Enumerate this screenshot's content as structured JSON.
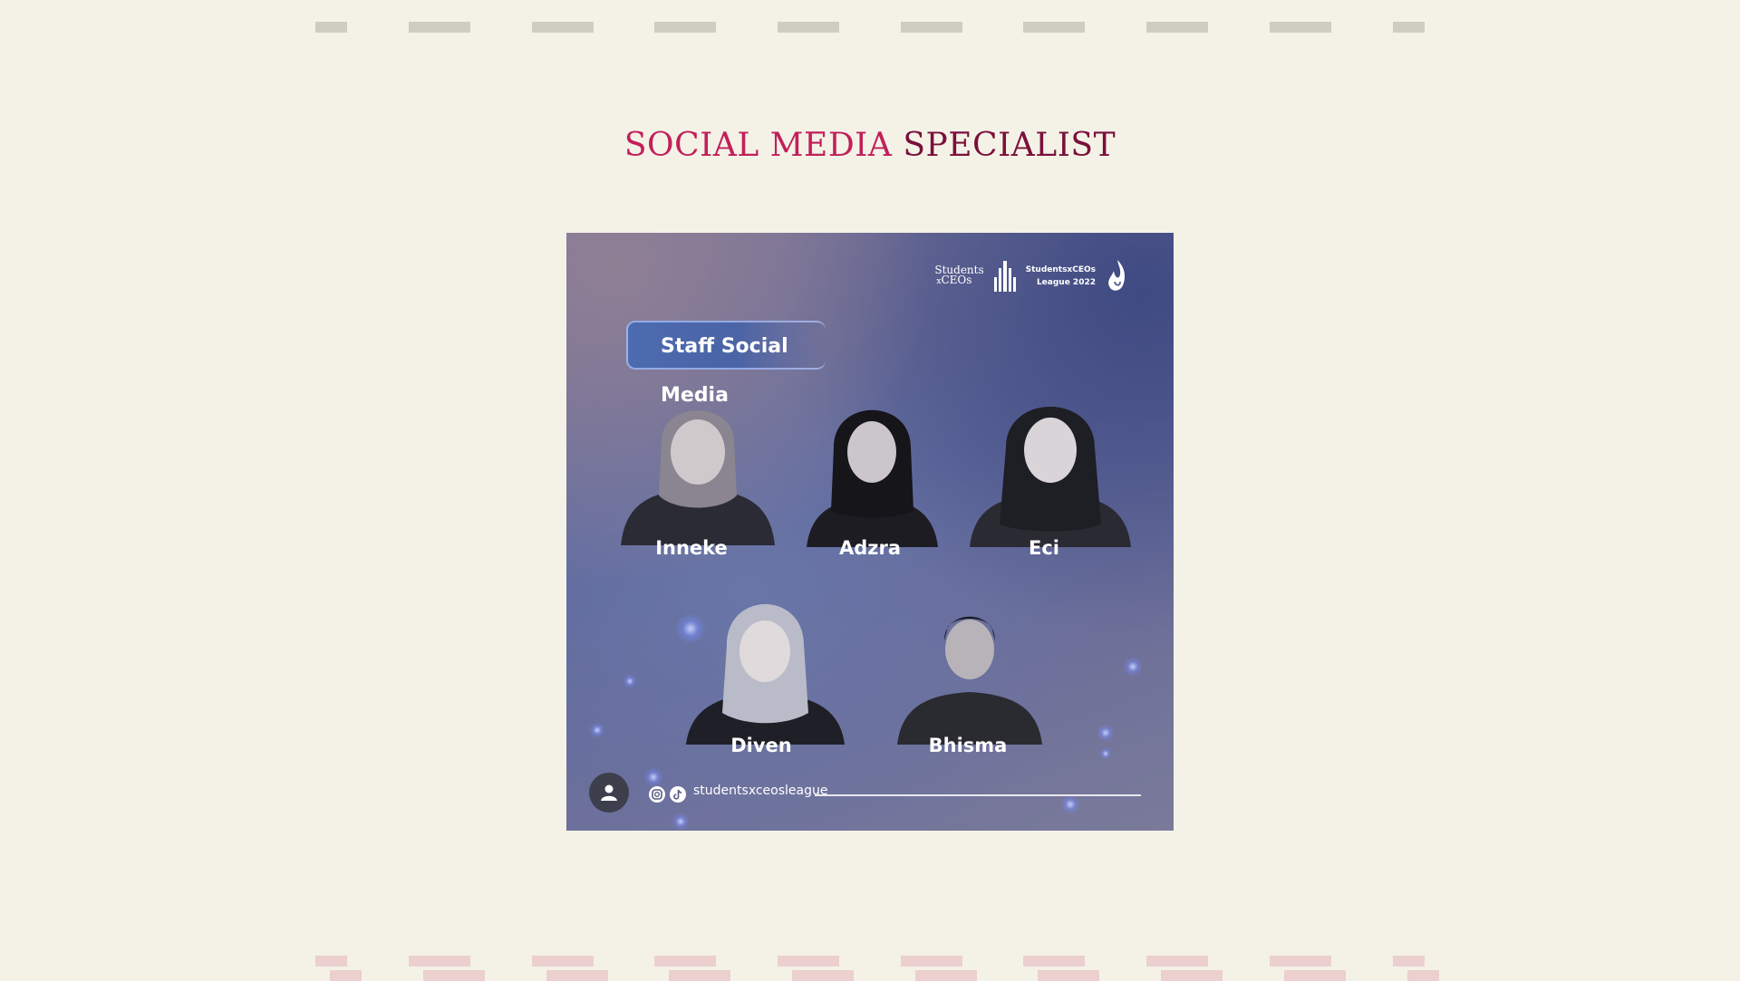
{
  "heading": {
    "part1": "SOCIAL MEDIA",
    "part2": "SPECIALIST"
  },
  "poster": {
    "badge": "Staff Social Media",
    "logo_left": [
      "Students",
      "x",
      "CEOs"
    ],
    "logo_right": [
      "StudentsxCEOs",
      "League 2022"
    ],
    "members": [
      "Inneke",
      "Adzra",
      "Eci",
      "Diven",
      "Bhisma"
    ],
    "handle": "studentsxceosleague",
    "icons": [
      "user-icon",
      "instagram-icon",
      "tiktok-icon"
    ]
  },
  "colors": {
    "background": "#f4f2e7",
    "title_accent": "#c21f5a",
    "title_dark": "#7b0f3a"
  }
}
